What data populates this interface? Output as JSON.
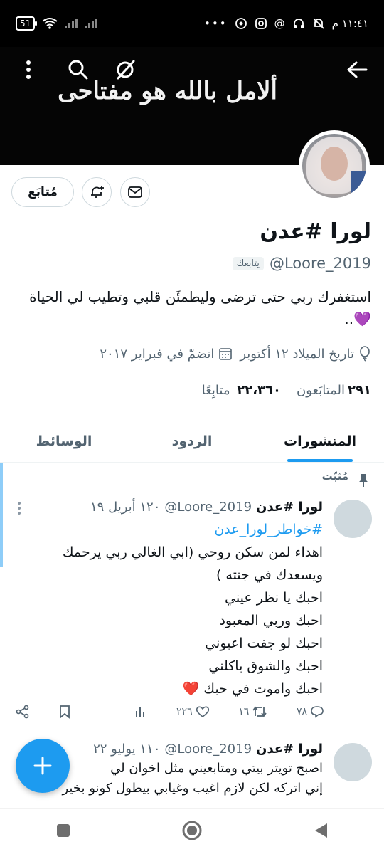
{
  "status_bar": {
    "time": "١١:٤١ م",
    "battery": "51"
  },
  "banner": {
    "text": "ألامل بالله هو مفتاحى"
  },
  "profile": {
    "name": "لورا #عدن",
    "handle": "@Loore_2019",
    "follows_you": "يتابعك",
    "bio": "استغفرك ربي حتى ترضى وليطمئَن قلبي وتطيب لي الحياة 💜..",
    "birthday": "تاريخ الميلاد ١٢ أكتوبر",
    "joined": "انضمّ في فبراير ٢٠١٧",
    "following_count": "٢٩١",
    "following_label": "المتابَعون",
    "followers_count": "٢٢،٣٦٠",
    "followers_label": "متابِعًا",
    "follow_button": "مُتابَع"
  },
  "tabs": [
    {
      "label": "المنشورات",
      "active": true
    },
    {
      "label": "الردود",
      "active": false
    },
    {
      "label": "الوسائط",
      "active": false
    }
  ],
  "pinned_label": "مُثبّت",
  "tweets": [
    {
      "name": "لورا #عدن",
      "handle": "@Loore_2019",
      "time": "١٢٠ أبريل ١٩",
      "hashtag": "#خواطر_لورا_عدن",
      "lines": [
        "اهداء لمن سكن روحي (ابي الغالي ربي يرحمك",
        "ويسعدك في جنته )",
        "احبك يا نظر عيني",
        "احبك وربي المعبود",
        "احبك لو جفت اعيوني",
        "احبك والشوق ياكلني",
        "احبك واموت في حبك ❤️"
      ],
      "replies": "٧٨",
      "retweets": "١٦",
      "likes": "٢٢٦"
    },
    {
      "name": "لورا #عدن",
      "handle": "@Loore_2019",
      "time": "١١٠ يوليو ٢٢",
      "lines": [
        "اصبح تويتر بيتي ومتابعيني مثل اخوان لي",
        "إني اتركه لكن لازم اغيب وغيابي بيطول كونو بخير"
      ]
    }
  ],
  "colors": {
    "accent": "#1d9bf0",
    "muted": "#536471",
    "pinned_bar": "#8ecdf8"
  },
  "icons": [
    "back-arrow-icon",
    "search-icon",
    "circle-slash-icon",
    "more-vertical-icon",
    "mail-icon",
    "bell-plus-icon",
    "pin-icon",
    "reply-icon",
    "retweet-icon",
    "heart-icon",
    "stats-icon",
    "bookmark-icon",
    "share-icon",
    "plus-icon"
  ]
}
